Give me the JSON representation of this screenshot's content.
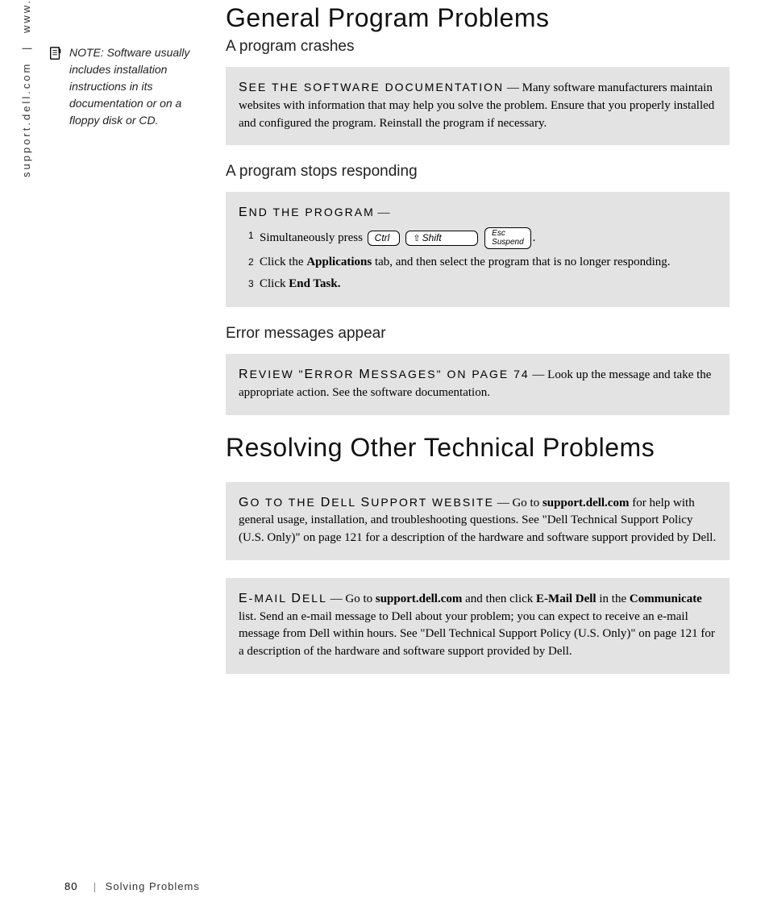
{
  "side": {
    "url1": "www.dell.com",
    "sep": "|",
    "url2": "support.dell.com"
  },
  "note": {
    "label": "NOTE:",
    "body": "Software usually includes installation instructions in its documentation or on a floppy disk or CD."
  },
  "h1a": "General Program Problems",
  "sec1": {
    "title": "A program crashes",
    "lead_first": "S",
    "lead_rest": "EE THE SOFTWARE DOCUMENTATION",
    "dash": "—",
    "body": "Many software manufacturers maintain websites with information that may help you solve the problem. Ensure that you properly installed and configured the program. Reinstall the program if necessary."
  },
  "sec2": {
    "title": "A program stops responding",
    "lead_first": "E",
    "lead_rest": "ND THE PROGRAM",
    "dash": "—",
    "steps": {
      "s1": {
        "n": "1",
        "pre": "Simultaneously press",
        "k1": "Ctrl",
        "k2": "Shift",
        "k3a": "Esc",
        "k3b": "Suspend",
        "post": "."
      },
      "s2": {
        "n": "2",
        "a": "Click the ",
        "b": "Applications",
        "c": " tab, and then select the program that is no longer responding."
      },
      "s3": {
        "n": "3",
        "a": "Click ",
        "b": "End Task."
      }
    }
  },
  "sec3": {
    "title": "Error messages appear",
    "lead_parts": {
      "a": "R",
      "b": "EVIEW \"",
      "c": "E",
      "d": "RROR ",
      "e": "M",
      "f": "ESSAGES\" ON PAGE 74"
    },
    "dash": "—",
    "body": "Look up the message and take the appropriate action. See the software documentation."
  },
  "h1b": "Resolving Other Technical Problems",
  "sec4": {
    "lead_parts": {
      "a": "G",
      "b": "O TO THE ",
      "c": "D",
      "d": "ELL ",
      "e": "S",
      "f": "UPPORT WEBSITE"
    },
    "dash": "—",
    "t1": "Go to ",
    "bold1": "support.dell.com",
    "t2": " for help with general usage, installation, and troubleshooting questions. See \"Dell Technical Support Policy (U.S. Only)\" on page 121 for a description of the hardware and software support provided by Dell."
  },
  "sec5": {
    "lead_parts": {
      "a": "E",
      "b": "-MAIL ",
      "c": "D",
      "d": "ELL"
    },
    "dash": "—",
    "t1": "Go to ",
    "bold1": "support.dell.com",
    "t2": " and then click ",
    "bold2": "E-Mail Dell",
    "t3": " in the ",
    "bold3": "Communicate",
    "t4": " list. Send an e-mail message to Dell about your problem; you can expect to receive an e-mail message from Dell within hours. See \"Dell Technical Support Policy (U.S. Only)\" on page 121 for a description of the hardware and software support provided by Dell."
  },
  "footer": {
    "page": "80",
    "section": "Solving Problems"
  }
}
